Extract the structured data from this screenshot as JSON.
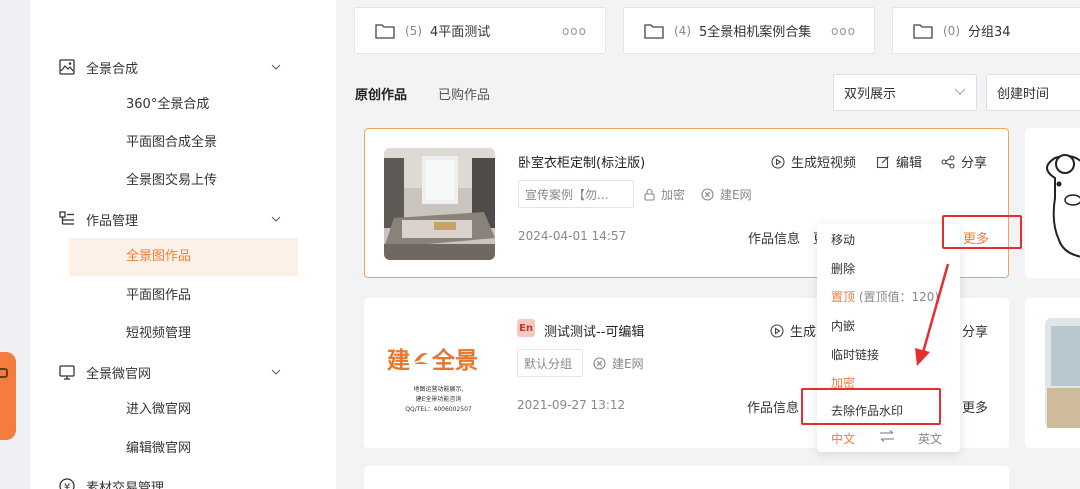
{
  "sidebar": {
    "groups": [
      {
        "label": "全景合成",
        "icon": "panorama-compose-icon"
      },
      {
        "label": "作品管理",
        "icon": "works-manage-icon"
      },
      {
        "label": "全景微官网",
        "icon": "micro-site-icon"
      },
      {
        "label": "素材交易管理",
        "icon": "asset-trade-icon"
      }
    ],
    "items": [
      {
        "label": "360°全景合成"
      },
      {
        "label": "平面图合成全景"
      },
      {
        "label": "全景图交易上传"
      },
      {
        "label": "全景图作品"
      },
      {
        "label": "平面图作品"
      },
      {
        "label": "短视频管理"
      },
      {
        "label": "进入微官网"
      },
      {
        "label": "编辑微官网"
      }
    ]
  },
  "folders": [
    {
      "count": "(5)",
      "name": "4平面测试",
      "more": "ooo"
    },
    {
      "count": "(4)",
      "name": "5全景相机案例合集",
      "more": "ooo"
    },
    {
      "count": "(0)",
      "name": "分组34",
      "more": ""
    }
  ],
  "tabs": [
    {
      "label": "原创作品"
    },
    {
      "label": "已购作品"
    }
  ],
  "selects": {
    "view": "双列展示",
    "sort": "创建时间"
  },
  "cards": [
    {
      "title": "卧室衣柜定制(标注版)",
      "group": "宣传案例【勿...",
      "encrypt": "加密",
      "site": "建E网",
      "date": "2024-04-01 14:57",
      "info": "作品信息",
      "info_tail": "更",
      "more": "更多",
      "actions": {
        "video": "生成短视频",
        "edit": "编辑",
        "share": "分享"
      }
    },
    {
      "badge": "En",
      "title": "测试测试--可编辑",
      "group": "默认分组",
      "site": "建E网",
      "date": "2021-09-27 13:12",
      "info": "作品信息",
      "more": "更多",
      "actions": {
        "video": "生成",
        "share": "分享"
      },
      "logo": {
        "brand": "建",
        "brand2": "全景",
        "line1": "地图运营功能展示,",
        "line2": "建E全景功能咨询",
        "line3": "QQ/TEL：4006002507"
      }
    }
  ],
  "menu": {
    "move": "移动",
    "delete": "删除",
    "pin": "置顶",
    "pin_value": "(置顶值：120)",
    "embed": "内嵌",
    "temp_link": "临时链接",
    "encrypt": "加密",
    "remove_watermark": "去除作品水印",
    "lang_zh": "中文",
    "lang_en": "英文"
  },
  "colors": {
    "accent": "#f47c3c",
    "highlight": "#e62e2e",
    "active_bg": "#fdf0e7"
  }
}
